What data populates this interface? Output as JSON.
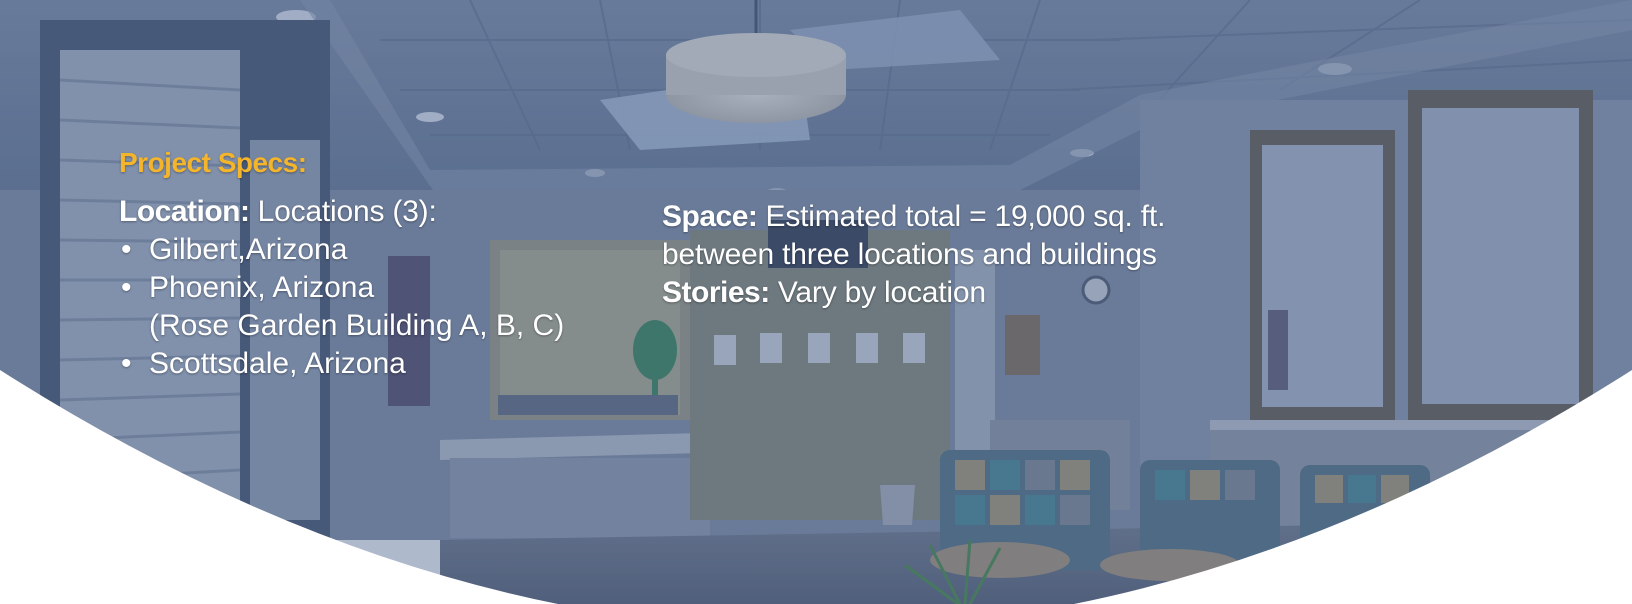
{
  "specs": {
    "heading": "Project Specs:",
    "location_label": "Location:",
    "location_value": "Locations (3):",
    "locations": [
      {
        "name": "Gilbert,Arizona"
      },
      {
        "name": "Phoenix, Arizona",
        "detail": "(Rose Garden Building A, B, C)"
      },
      {
        "name": "Scottsdale, Arizona"
      }
    ]
  },
  "space": {
    "label": "Space:",
    "value_line1": "Estimated total = 19,000 sq. ft.",
    "value_line2": "between three locations and buildings",
    "stories_label": "Stories:",
    "stories_value": "Vary by location"
  },
  "colors": {
    "heading": "#f5b52a",
    "text": "#ffffff",
    "overlay": "#3f5a85",
    "curve": "#ffffff"
  }
}
